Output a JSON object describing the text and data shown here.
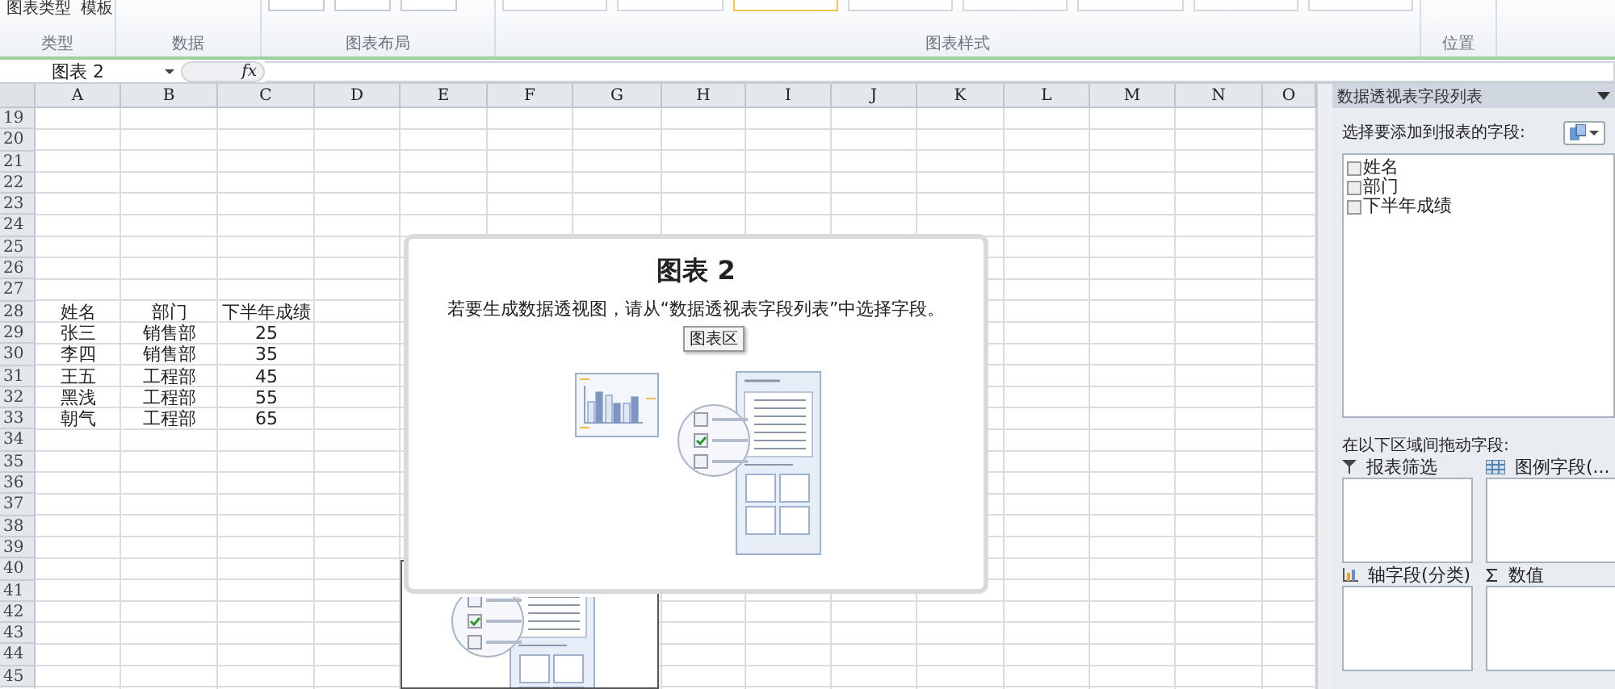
{
  "ribbon": {
    "top_buttons": [
      "图表类型",
      "模板"
    ],
    "groups": [
      {
        "label": "类型"
      },
      {
        "label": "数据"
      },
      {
        "label": "图表布局"
      },
      {
        "label": "图表样式"
      },
      {
        "label": "位置"
      }
    ]
  },
  "formula_bar": {
    "name_box": "图表 2",
    "function_label": "fx"
  },
  "sheet": {
    "columns": [
      "A",
      "B",
      "C",
      "D",
      "E",
      "F",
      "G",
      "H",
      "I",
      "J",
      "K",
      "L",
      "M",
      "N",
      "O"
    ],
    "rows": [
      {
        "header": "19"
      },
      {
        "header": "20"
      },
      {
        "header": "21"
      },
      {
        "header": "22"
      },
      {
        "header": "23"
      },
      {
        "header": "24"
      },
      {
        "header": "25"
      },
      {
        "header": "26"
      },
      {
        "header": "27"
      },
      {
        "header": "28",
        "cells": [
          "姓名",
          "部门",
          "下半年成绩"
        ]
      },
      {
        "header": "29",
        "cells": [
          "张三",
          "销售部",
          "25"
        ]
      },
      {
        "header": "30",
        "cells": [
          "李四",
          "销售部",
          "35"
        ]
      },
      {
        "header": "31",
        "cells": [
          "王五",
          "工程部",
          "45"
        ]
      },
      {
        "header": "32",
        "cells": [
          "黑浅",
          "工程部",
          "55"
        ]
      },
      {
        "header": "33",
        "cells": [
          "朝气",
          "工程部",
          "65"
        ]
      },
      {
        "header": "34"
      },
      {
        "header": "35"
      },
      {
        "header": "36"
      },
      {
        "header": "37"
      },
      {
        "header": "38"
      },
      {
        "header": "39"
      },
      {
        "header": "40"
      },
      {
        "header": "41"
      },
      {
        "header": "42"
      },
      {
        "header": "43"
      },
      {
        "header": "44"
      },
      {
        "header": "45"
      }
    ]
  },
  "chart": {
    "title": "图表 2",
    "message": "若要生成数据透视图，请从“数据透视表字段列表”中选择字段。",
    "tooltip": "图表区"
  },
  "panel": {
    "title": "数据透视表字段列表",
    "choose_label": "选择要添加到报表的字段:",
    "fields": [
      {
        "label": "姓名",
        "checked": false
      },
      {
        "label": "部门",
        "checked": false
      },
      {
        "label": "下半年成绩",
        "checked": false
      }
    ],
    "drag_label": "在以下区域间拖动字段:",
    "areas": [
      {
        "label": "报表筛选",
        "kind": "filter"
      },
      {
        "label": "图例字段(...",
        "kind": "legend"
      },
      {
        "label": "轴字段(分类)",
        "kind": "axis"
      },
      {
        "label": "数值",
        "kind": "values"
      }
    ]
  }
}
